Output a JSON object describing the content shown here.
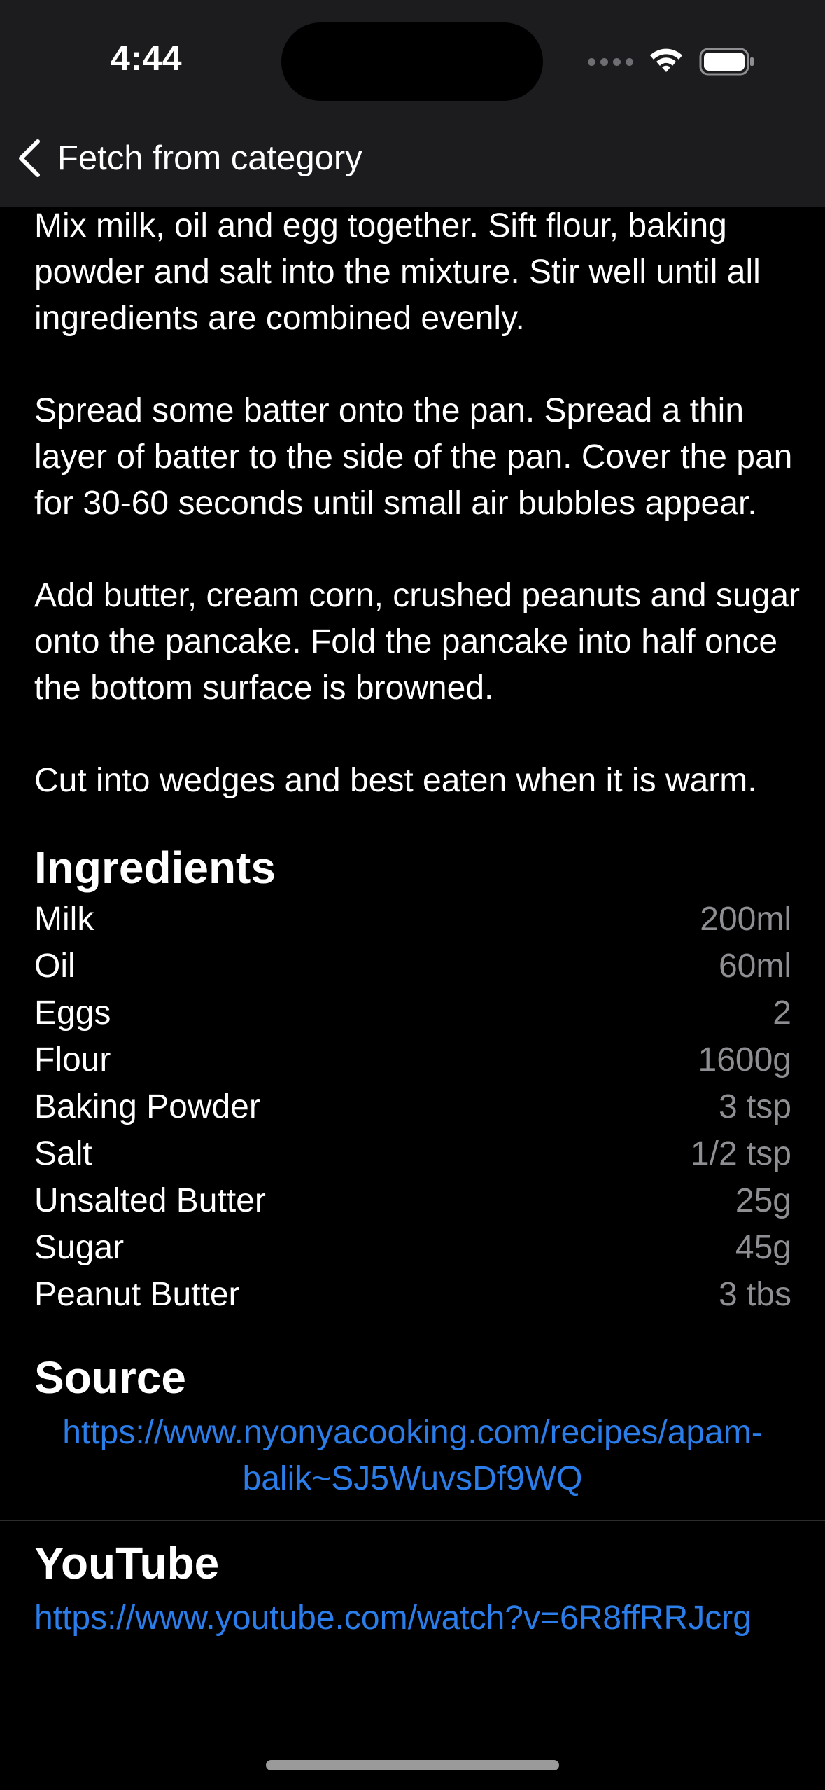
{
  "status_bar": {
    "time": "4:44"
  },
  "nav": {
    "back_label": "Fetch from category"
  },
  "instructions": [
    "Mix milk, oil and egg together. Sift flour, baking powder and salt into the mixture. Stir well until all ingredients are combined evenly.",
    "Spread some batter onto the pan. Spread a thin layer of batter to the side of the pan. Cover the pan for 30-60 seconds until small air bubbles appear.",
    "Add butter, cream corn, crushed peanuts and sugar onto the pancake. Fold the pancake into half once the bottom surface is browned.",
    "Cut into wedges and best eaten when it is warm."
  ],
  "ingredients": {
    "title": "Ingredients",
    "items": [
      {
        "name": "Milk",
        "measure": "200ml"
      },
      {
        "name": "Oil",
        "measure": "60ml"
      },
      {
        "name": "Eggs",
        "measure": "2"
      },
      {
        "name": "Flour",
        "measure": "1600g"
      },
      {
        "name": "Baking Powder",
        "measure": "3 tsp"
      },
      {
        "name": "Salt",
        "measure": "1/2 tsp"
      },
      {
        "name": "Unsalted Butter",
        "measure": "25g"
      },
      {
        "name": "Sugar",
        "measure": "45g"
      },
      {
        "name": "Peanut Butter",
        "measure": "3 tbs"
      }
    ]
  },
  "source": {
    "title": "Source",
    "url_line1": "https://www.nyonyacooking.com/recipes/apam-",
    "url_line2": "balik~SJ5WuvsDf9WQ"
  },
  "youtube": {
    "title": "YouTube",
    "url": "https://www.youtube.com/watch?v=6R8ffRRJcrg"
  },
  "colors": {
    "background": "#000000",
    "bar_background": "#1c1c1e",
    "link": "#2b7de9",
    "secondary_text": "#8e8e93"
  },
  "icons": [
    "chevron-left-icon",
    "cellular-signal-icon",
    "wifi-icon",
    "battery-icon"
  ]
}
